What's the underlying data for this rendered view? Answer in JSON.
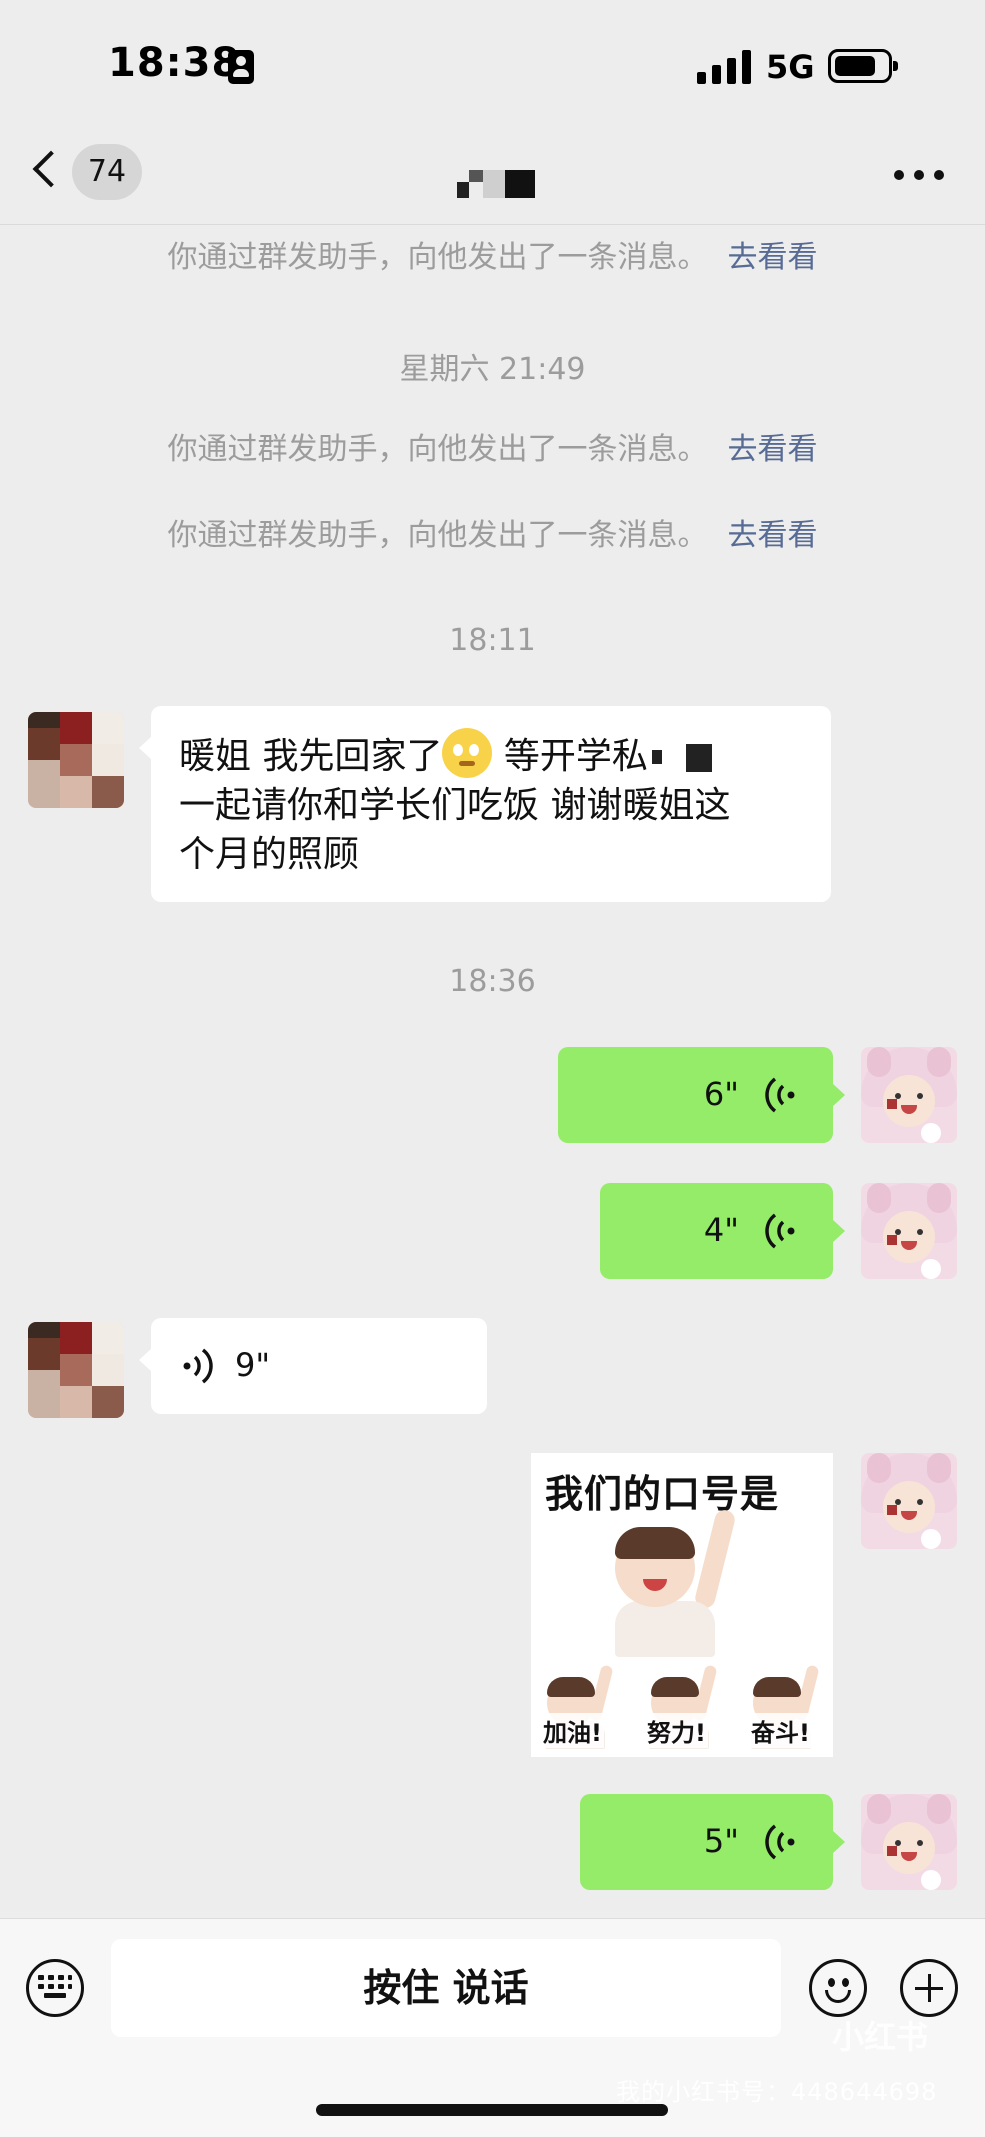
{
  "status_bar": {
    "time": "18:38",
    "network": "5G"
  },
  "nav": {
    "unread_count": "74"
  },
  "messages": {
    "system_note": "你通过群发助手，向他发出了一条消息。",
    "system_link": "去看看",
    "timestamp_1": "星期六 21:49",
    "timestamp_2": "18:11",
    "timestamp_3": "18:36",
    "incoming_text": {
      "line1_a": "暖姐 我先回家了",
      "line1_b": "等开学私",
      "line2": "一起请你和学长们吃饭 谢谢暖姐这",
      "line3": "个月的照顾"
    },
    "voice_out_1": "6\"",
    "voice_out_2": "4\"",
    "voice_in": "9\"",
    "voice_out_3": "5\"",
    "sticker": {
      "title": "我们的口号是",
      "captions": [
        "加油!",
        "努力!",
        "奋斗!"
      ]
    }
  },
  "input_bar": {
    "hold_to_talk": "按住 说话"
  },
  "watermark": {
    "logo": "小红书",
    "id": "我的小红书号：448644698"
  },
  "colors": {
    "background": "#ededed",
    "outgoing_bubble": "#95ec69",
    "incoming_bubble": "#ffffff",
    "link": "#576b95",
    "system_text": "#9c9c9c"
  }
}
